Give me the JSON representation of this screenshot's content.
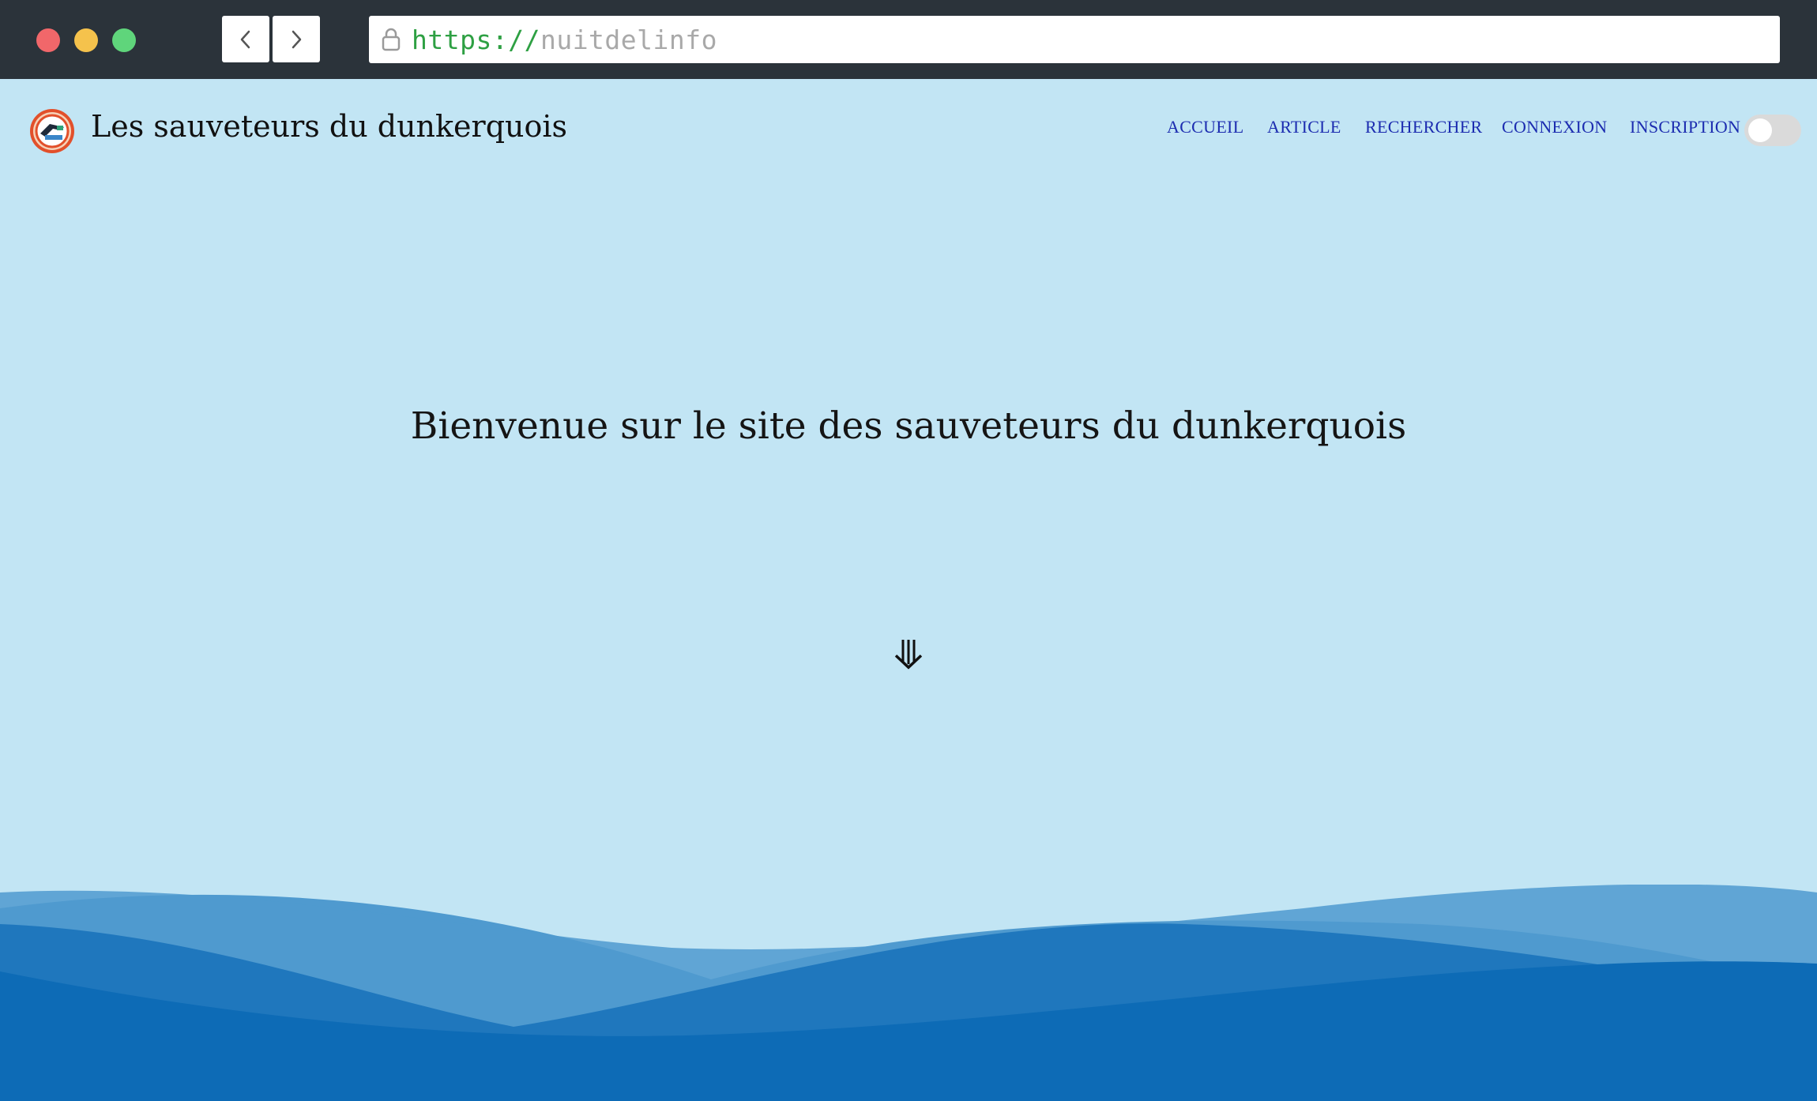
{
  "browser": {
    "url_scheme": "https://",
    "url_host": "nuitdelinfo",
    "back_icon": "chevron-left-icon",
    "forward_icon": "chevron-right-icon",
    "lock_icon": "lock-icon"
  },
  "header": {
    "site_title": "Les sauveteurs du dunkerquois",
    "nav": [
      "ACCUEIL",
      "ARTICLE",
      "RECHERCHER",
      "CONNEXION",
      "INSCRIPTION"
    ],
    "theme_toggle_on": false
  },
  "hero": {
    "title": "Bienvenue sur le site des sauveteurs du dunkerquois",
    "scroll_icon": "triple-down-arrow-icon"
  },
  "colors": {
    "page_bg": "#c2e5f4",
    "nav_link": "#1c2cb0",
    "wave_light": "#4f9acf",
    "wave_mid": "#1f77bd",
    "wave_dark": "#0d6bb6"
  }
}
